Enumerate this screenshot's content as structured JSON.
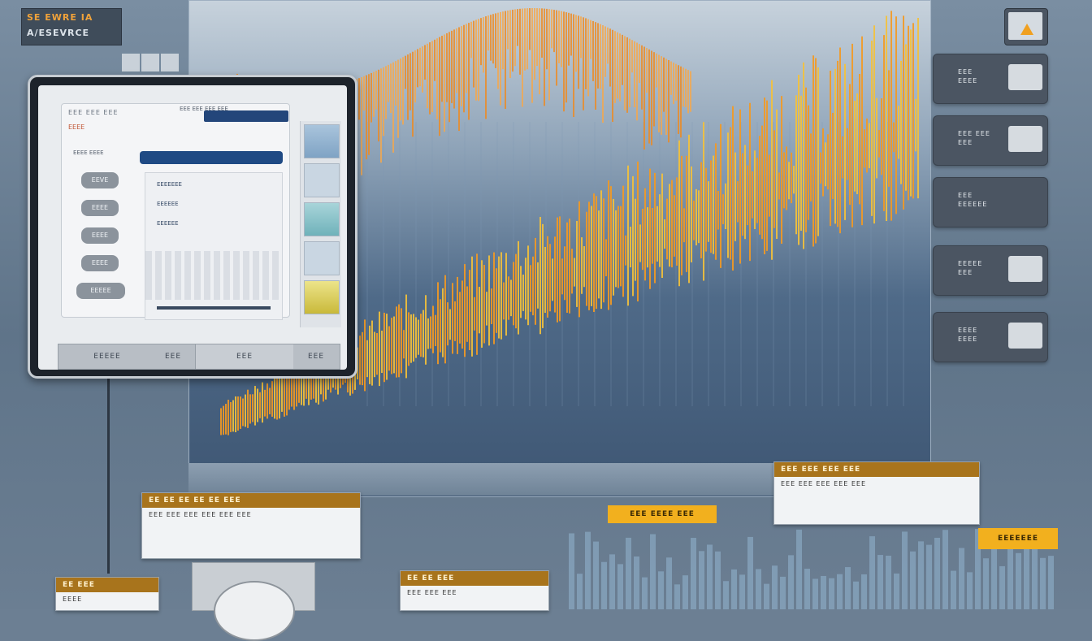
{
  "logo": {
    "line1": "SE EWRE IA",
    "line2": "A/ESEVRCE"
  },
  "tablet": {
    "app_title": "EEE EEE EEE",
    "app_sub": "EEEE",
    "top_chips": "EEE EEE  EEE EEE",
    "side_heading": "EEEE  EEEE",
    "side_buttons": [
      "EEVE",
      "EEEE",
      "EEEE",
      "EEEE",
      "EEEEE"
    ],
    "content_rows": [
      "EEEEEEE",
      "EEEEEE",
      "EEEEEE"
    ],
    "tabs": [
      "EEEEE",
      "EEE",
      "EEE",
      "EEE"
    ]
  },
  "right_cards": [
    {
      "line1": "EEE",
      "line2": "EEEE"
    },
    {
      "line1": "EEE EEE",
      "line2": "EEE"
    },
    {
      "line1": "EEE",
      "line2": "EEEEEE"
    },
    {
      "line1": "EEEEE",
      "line2": "EEE"
    },
    {
      "line1": "EEEE",
      "line2": "EEEE"
    }
  ],
  "panels": {
    "left_header": "EE EE EE EE EE EEE",
    "left_body": "EEE  EEE  EEE  EEE  EEE  EEE",
    "right_header": "EEE  EEE  EEE  EEE",
    "right_body": "EEE  EEE  EEE  EEE  EEE",
    "bottom_small_header": "EE EEE",
    "bottom_small_body": "EEEE",
    "bottom_mid_header": "EE EE EEE",
    "bottom_mid_body": "EEE  EEE  EEE"
  },
  "tags": {
    "center": "EEE EEEE EEE",
    "right": "EEEEEEE"
  },
  "colors": {
    "accent_orange": "#f08a1e",
    "accent_yellow": "#f2b01e",
    "navy": "#1f4a84"
  }
}
